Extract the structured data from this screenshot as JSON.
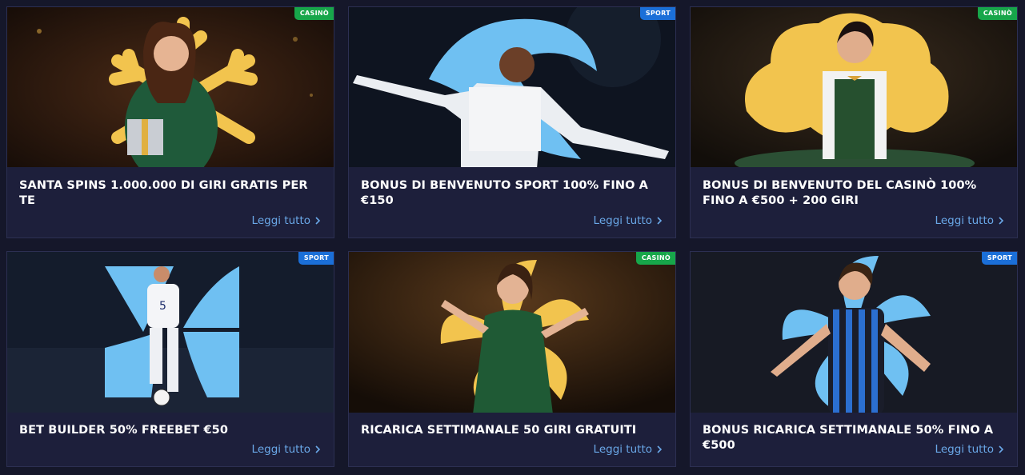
{
  "cards": [
    {
      "category": "CASINÒ",
      "title": "SANTA SPINS 1.000.000 DI GIRI GRATIS PER TE",
      "link": "Leggi tutto"
    },
    {
      "category": "SPORT",
      "title": "BONUS DI BENVENUTO SPORT 100% FINO A €150",
      "link": "Leggi tutto"
    },
    {
      "category": "CASINÒ",
      "title": "BONUS DI BENVENUTO DEL CASINÒ 100% FINO A €500 + 200 GIRI",
      "link": "Leggi tutto"
    },
    {
      "category": "SPORT",
      "title": "BET BUILDER 50% FREEBET €50",
      "link": "Leggi tutto"
    },
    {
      "category": "CASINÒ",
      "title": "RICARICA SETTIMANALE 50 GIRI GRATUITI",
      "link": "Leggi tutto"
    },
    {
      "category": "SPORT",
      "title": "BONUS RICARICA SETTIMANALE 50% FINO A €500",
      "link": "Leggi tutto"
    }
  ],
  "colors": {
    "page_bg": "#15172a",
    "card_bg": "#1d1f3b",
    "link": "#6aa8e8",
    "casino_badge": "#17a64a",
    "sport_badge": "#1b6fd8",
    "gold": "#f2c44e",
    "sky_blue": "#6fc0f2"
  },
  "icons": {
    "link_arrow": "chevron-right-icon"
  }
}
